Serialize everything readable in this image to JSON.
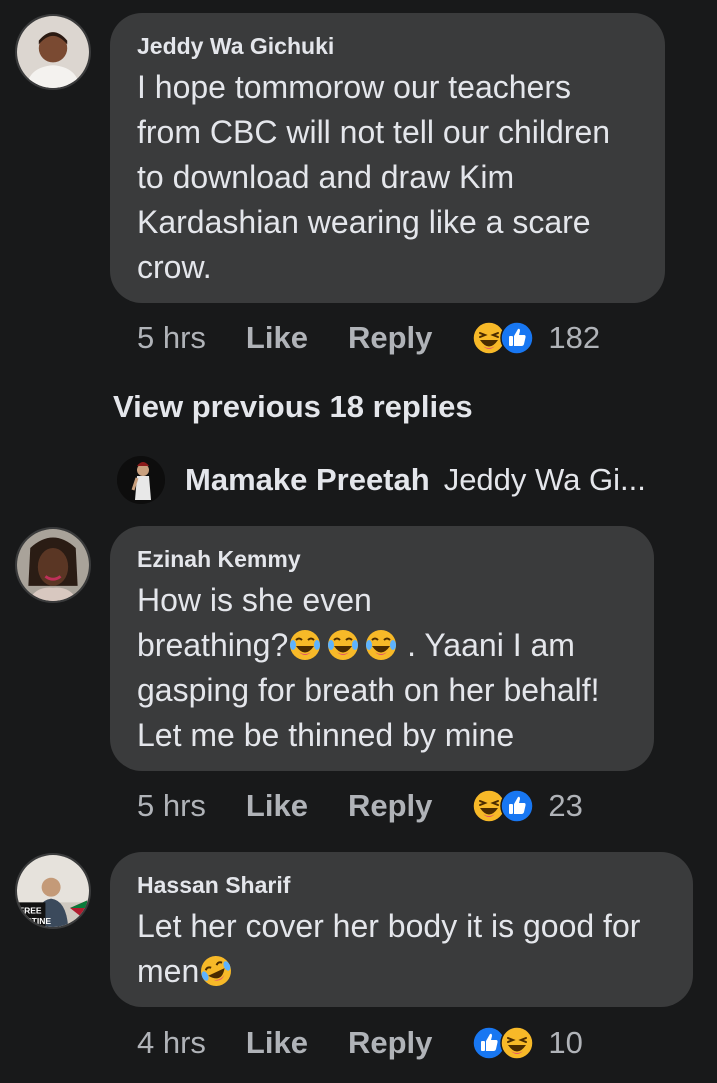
{
  "comments": [
    {
      "author": "Jeddy Wa Gichuki",
      "lines": [
        "I hope tommorow our teachers",
        "from CBC will not tell our children",
        "to download and draw Kim",
        "Kardashian wearing like a scare",
        "crow."
      ],
      "time": "5 hrs",
      "like_label": "Like",
      "reply_label": "Reply",
      "reaction_count": "182",
      "reactions": [
        "haha-icon",
        "like-icon"
      ]
    },
    {
      "author": "Ezinah Kemmy",
      "line1": "How is she even",
      "line2_prefix": "breathing?",
      "line2_suffix": " . Yaani I am",
      "line3": "gasping for breath on her behalf!",
      "line4": "Let me be thinned by mine",
      "time": "5 hrs",
      "like_label": "Like",
      "reply_label": "Reply",
      "reaction_count": "23",
      "reactions": [
        "haha-icon",
        "like-icon"
      ]
    },
    {
      "author": "Hassan Sharif",
      "line1": "Let her cover her body it is good for",
      "line2": "men",
      "time": "4 hrs",
      "like_label": "Like",
      "reply_label": "Reply",
      "reaction_count": "10",
      "reactions": [
        "like-icon",
        "haha-icon"
      ],
      "avatar_badge_lines": [
        "FREE",
        "LESTINE"
      ]
    }
  ],
  "view_previous": "View previous 18 replies",
  "reply_preview": {
    "name": "Mamake Preetah",
    "snippet": "Jeddy Wa Gi..."
  },
  "colors": {
    "background": "#18191a",
    "bubble": "#3a3b3c",
    "text": "#e4e6eb",
    "meta": "#b0b3b8",
    "like_blue": "#1877f2",
    "haha_yellow": "#f7b928"
  }
}
